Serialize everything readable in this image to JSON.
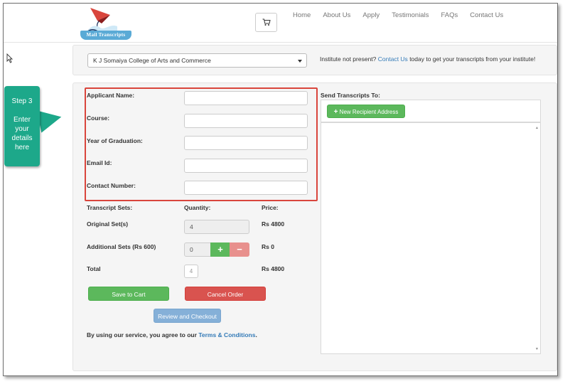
{
  "header": {
    "logo_text": "Mail Transcripts",
    "nav": [
      "Home",
      "About Us",
      "Apply",
      "Testimonials",
      "FAQs",
      "Contact Us"
    ]
  },
  "institute": {
    "selected": "K J Somaiya College of Arts and Commerce",
    "note_prefix": "Institute not present?",
    "note_link": "Contact Us",
    "note_suffix": "today to get your transcripts from your institute!"
  },
  "form": {
    "applicant_name_label": "Applicant Name:",
    "course_label": "Course:",
    "year_label": "Year of Graduation:",
    "email_label": "Email Id:",
    "contact_label": "Contact Number:"
  },
  "sets": {
    "col_transcript": "Transcript Sets:",
    "col_quantity": "Quantity:",
    "col_price": "Price:",
    "original_label": "Original Set(s)",
    "original_qty": "4",
    "original_price": "Rs 4800",
    "additional_label": "Additional Sets (Rs 600)",
    "additional_qty": "0",
    "additional_price": "Rs 0",
    "plus": "+",
    "minus": "−",
    "total_label": "Total",
    "total_qty": "4",
    "total_price": "Rs 4800"
  },
  "buttons": {
    "save": "Save to Cart",
    "cancel": "Cancel Order",
    "review": "Review and Checkout"
  },
  "terms": {
    "prefix": "By using our service, you agree to our",
    "link": "Terms & Conditions",
    "suffix": "."
  },
  "send": {
    "heading": "Send Transcripts To:",
    "new_recipient": "New Recipient Address",
    "new_recipient_icon": "+"
  },
  "callout": {
    "step": "Step 3",
    "desc_lines": [
      "Enter",
      "your",
      "details",
      "here"
    ]
  },
  "colors": {
    "callout": "#1da88a",
    "highlight": "#d9453c",
    "success": "#5cb85c",
    "danger": "#d9534f",
    "link": "#337ab7"
  }
}
